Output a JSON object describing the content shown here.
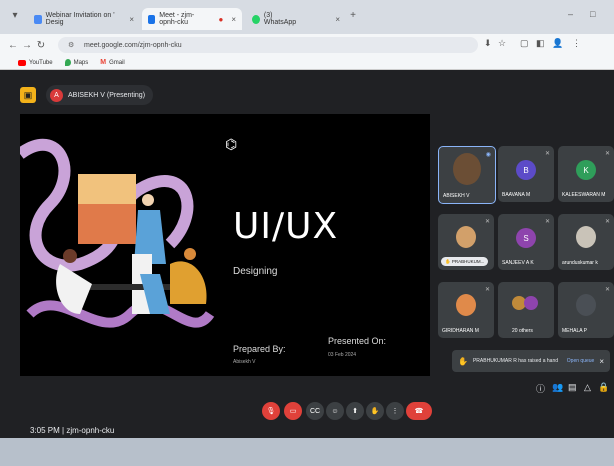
{
  "browser": {
    "tabs": [
      {
        "label": "Webinar Invitation on ' Desig",
        "color": "#4a8af4"
      },
      {
        "label": "Meet - zjm-opnh-cku",
        "color": "#1a73e8"
      },
      {
        "label": "(3) WhatsApp",
        "color": "#25d366"
      }
    ],
    "url": "meet.google.com/zjm-opnh-cku",
    "bookmarks": [
      {
        "label": "YouTube",
        "color": "#ff0000"
      },
      {
        "label": "Maps",
        "color": "#34a853"
      },
      {
        "label": "Gmail",
        "color": "#ea4335"
      }
    ]
  },
  "meet": {
    "presenter_initial": "A",
    "presenter_label": "ABISEKH V (Presenting)",
    "slide": {
      "title": "UI/UX",
      "subtitle": "Designing",
      "prepared_by_label": "Prepared By:",
      "prepared_by_name": "Abisekh V",
      "presented_on_label": "Presented On:",
      "presented_on_date": "03 Feb 2024"
    },
    "participants": [
      {
        "name": "ABISEKH V",
        "kind": "photo"
      },
      {
        "name": "BAAVANA M",
        "initial": "B",
        "color": "#5c4bc8"
      },
      {
        "name": "KALEESWARAN M",
        "initial": "K",
        "color": "#2f9e5a"
      },
      {
        "name": "PRABHUKUM...",
        "kind": "chip"
      },
      {
        "name": "SANJEEV A K",
        "initial": "S",
        "color": "#8e44ad"
      },
      {
        "name": "arunduskumar k",
        "kind": "photo"
      },
      {
        "name": "GIRIDHARAN M",
        "kind": "photo"
      },
      {
        "name": "20 others",
        "kind": "group"
      },
      {
        "name": "MEHALA P",
        "kind": "photo"
      }
    ],
    "notification": {
      "text": "PRABHUKUMAR R has raised a hand",
      "link": "Open queue"
    },
    "time_meeting": "3:05 PM  |  zjm-opnh-cku"
  }
}
